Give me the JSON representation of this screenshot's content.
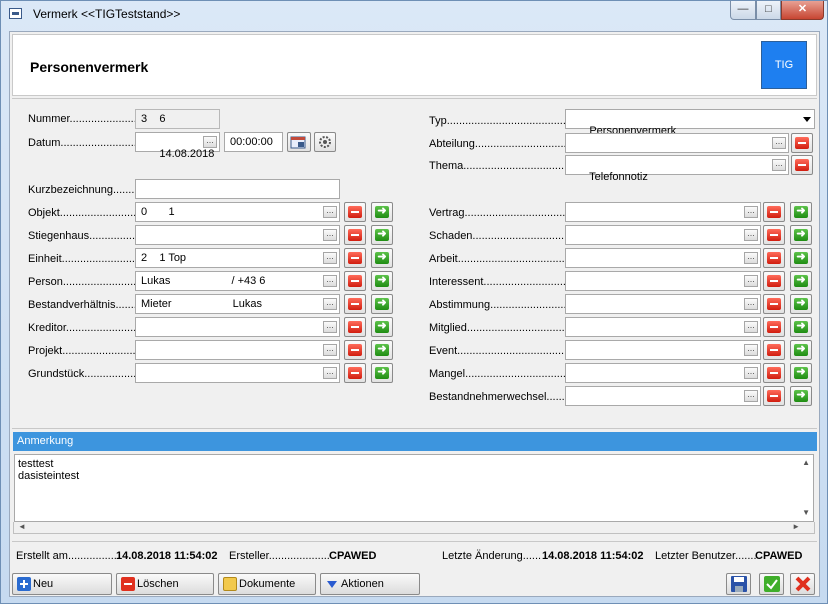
{
  "window": {
    "title": "Vermerk  <<TIGTeststand>>",
    "min_label": "—",
    "max_label": "□",
    "close_label": "✕"
  },
  "header": {
    "title": "Personenvermerk",
    "logo_text": "TIG"
  },
  "left": {
    "nummer_label": "Nummer........................",
    "nummer_value": "3    6",
    "datum_label": "Datum.............................",
    "datum_value": "14.08.2018",
    "zeit_value": "00:00:00",
    "kurz_label": "Kurzbezeichnung.......",
    "kurz_value": "",
    "rows": [
      {
        "label": "Objekt................................",
        "value": "0       1"
      },
      {
        "label": "Stiegenhaus....................",
        "value": ""
      },
      {
        "label": "Einheit..............................",
        "value": "2    1 Top"
      },
      {
        "label": "Person...............................",
        "value": "Lukas                    / +43 6                           2"
      },
      {
        "label": "Bestandverhältnis.........",
        "value": "Mieter                    Lukas"
      },
      {
        "label": "Kreditor...........................",
        "value": ""
      },
      {
        "label": "Projekt..............................",
        "value": ""
      },
      {
        "label": "Grundstück......................",
        "value": ""
      }
    ]
  },
  "right": {
    "typ_label": "Typ.......................................",
    "typ_value": "Personenvermerk",
    "abteilung_label": "Abteilung..............................",
    "abteilung_value": "",
    "thema_label": "Thema.....................................",
    "thema_value": "Telefonnotiz",
    "rows": [
      {
        "label": "Vertrag...................................",
        "value": ""
      },
      {
        "label": "Schaden.................................",
        "value": ""
      },
      {
        "label": "Arbeit......................................",
        "value": ""
      },
      {
        "label": "Interessent.............................",
        "value": ""
      },
      {
        "label": "Abstimmung..........................",
        "value": ""
      },
      {
        "label": "Mitglied...................................",
        "value": ""
      },
      {
        "label": "Event.......................................",
        "value": ""
      },
      {
        "label": "Mangel.....................................",
        "value": ""
      },
      {
        "label": "Bestandnehmerwechsel......",
        "value": ""
      }
    ]
  },
  "anmerkung": {
    "header": "Anmerkung",
    "lines": [
      "testtest",
      "dasisteintest"
    ]
  },
  "footer": {
    "erstellt_label": "Erstellt am.................",
    "erstellt_value": "14.08.2018 11:54:02",
    "ersteller_label": "Ersteller....................",
    "ersteller_value": "CPAWED",
    "aenderung_label": "Letzte Änderung......",
    "aenderung_value": "14.08.2018 11:54:02",
    "benutzer_label": "Letzter Benutzer.......",
    "benutzer_value": "CPAWED"
  },
  "toolbar": {
    "neu": "Neu",
    "loeschen": "Löschen",
    "dokumente": "Dokumente",
    "aktionen": "Aktionen"
  },
  "ellipsis": "..."
}
